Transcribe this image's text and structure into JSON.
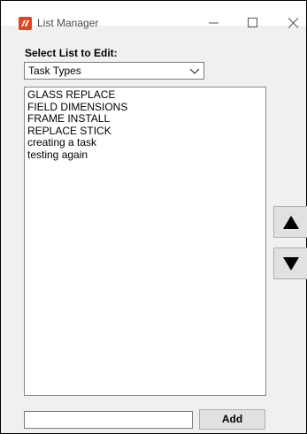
{
  "window": {
    "title": "List Manager",
    "controls": [
      "minimize-icon",
      "maximize-icon",
      "close-icon"
    ]
  },
  "selector": {
    "label": "Select List to Edit:",
    "selected": "Task Types"
  },
  "list": {
    "items": [
      "GLASS REPLACE",
      "FIELD DIMENSIONS",
      "FRAME INSTALL",
      "REPLACE STICK",
      "creating a task",
      "testing again"
    ]
  },
  "reorder": {
    "up_icon": "arrow-up-icon",
    "down_icon": "arrow-down-icon"
  },
  "add": {
    "input_value": "",
    "button_label": "Add"
  },
  "colors": {
    "app_icon": "#e8401c",
    "window_bg": "#f0f0f0",
    "button_bg": "#e1e1e1"
  }
}
